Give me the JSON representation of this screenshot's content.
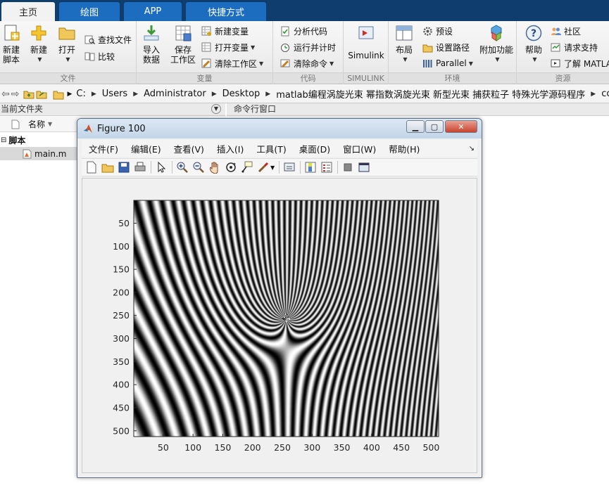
{
  "tabs": [
    "主页",
    "绘图",
    "APP",
    "快捷方式"
  ],
  "ribbon": {
    "file": {
      "label": "文件",
      "new_script": "新建\n脚本",
      "new": "新建",
      "open": "打开",
      "find_files": "查找文件",
      "compare": "比较"
    },
    "variable": {
      "label": "变量",
      "import": "导入\n数据",
      "save_ws": "保存\n工作区",
      "new_var": "新建变量",
      "open_var": "打开变量",
      "clear_ws": "清除工作区"
    },
    "code": {
      "label": "代码",
      "analyze": "分析代码",
      "run_time": "运行并计时",
      "clear_cmd": "清除命令"
    },
    "simulink": {
      "label": "SIMULINK",
      "btn": "Simulink"
    },
    "env": {
      "label": "环境",
      "layout": "布局",
      "prefs": "预设",
      "set_path": "设置路径",
      "parallel": "Parallel",
      "addons": "附加功能"
    },
    "resources": {
      "label": "资源",
      "help": "帮助",
      "community": "社区",
      "support": "请求支持",
      "learn": "了解 MATLAB"
    }
  },
  "address": {
    "crumbs": [
      "C:",
      "Users",
      "Administrator",
      "Desktop",
      "matlab编程涡旋光束 幂指数涡旋光束 新型光束 捕获粒子 特殊光学源码程序",
      "code"
    ]
  },
  "panels": {
    "current_folder": "当前文件夹",
    "command_window": "命令行窗口",
    "name_col": "名称",
    "tree_group": "脚本",
    "tree_file": "main.m"
  },
  "figure": {
    "title": "Figure 100",
    "menus": [
      "文件(F)",
      "编辑(E)",
      "查看(V)",
      "插入(I)",
      "工具(T)",
      "桌面(D)",
      "窗口(W)",
      "帮助(H)"
    ],
    "toolbar_icons": [
      "new-figure-icon",
      "open-icon",
      "save-icon",
      "print-icon",
      "pointer-icon",
      "zoom-in-icon",
      "zoom-out-icon",
      "pan-icon",
      "rotate-icon",
      "data-cursor-icon",
      "brush-icon",
      "link-icon",
      "colorbar-icon",
      "legend-icon",
      "hide-tools-icon",
      "show-tools-icon"
    ]
  },
  "chart_data": {
    "type": "heatmap",
    "description_kind": "image",
    "xticks": [
      50,
      100,
      150,
      200,
      250,
      300,
      350,
      400,
      450,
      500
    ],
    "yticks": [
      50,
      100,
      150,
      200,
      250,
      300,
      350,
      400,
      450,
      500
    ],
    "xlim": [
      0.5,
      512.5
    ],
    "ylim": [
      0.5,
      512.5
    ],
    "y_direction": "reverse",
    "colormap": "gray",
    "vortex_center": [
      256,
      256
    ]
  },
  "colors": {
    "tab_bg": "#0f3e6e",
    "tab": "#1c6dbf",
    "ribbon": "#efefef"
  }
}
